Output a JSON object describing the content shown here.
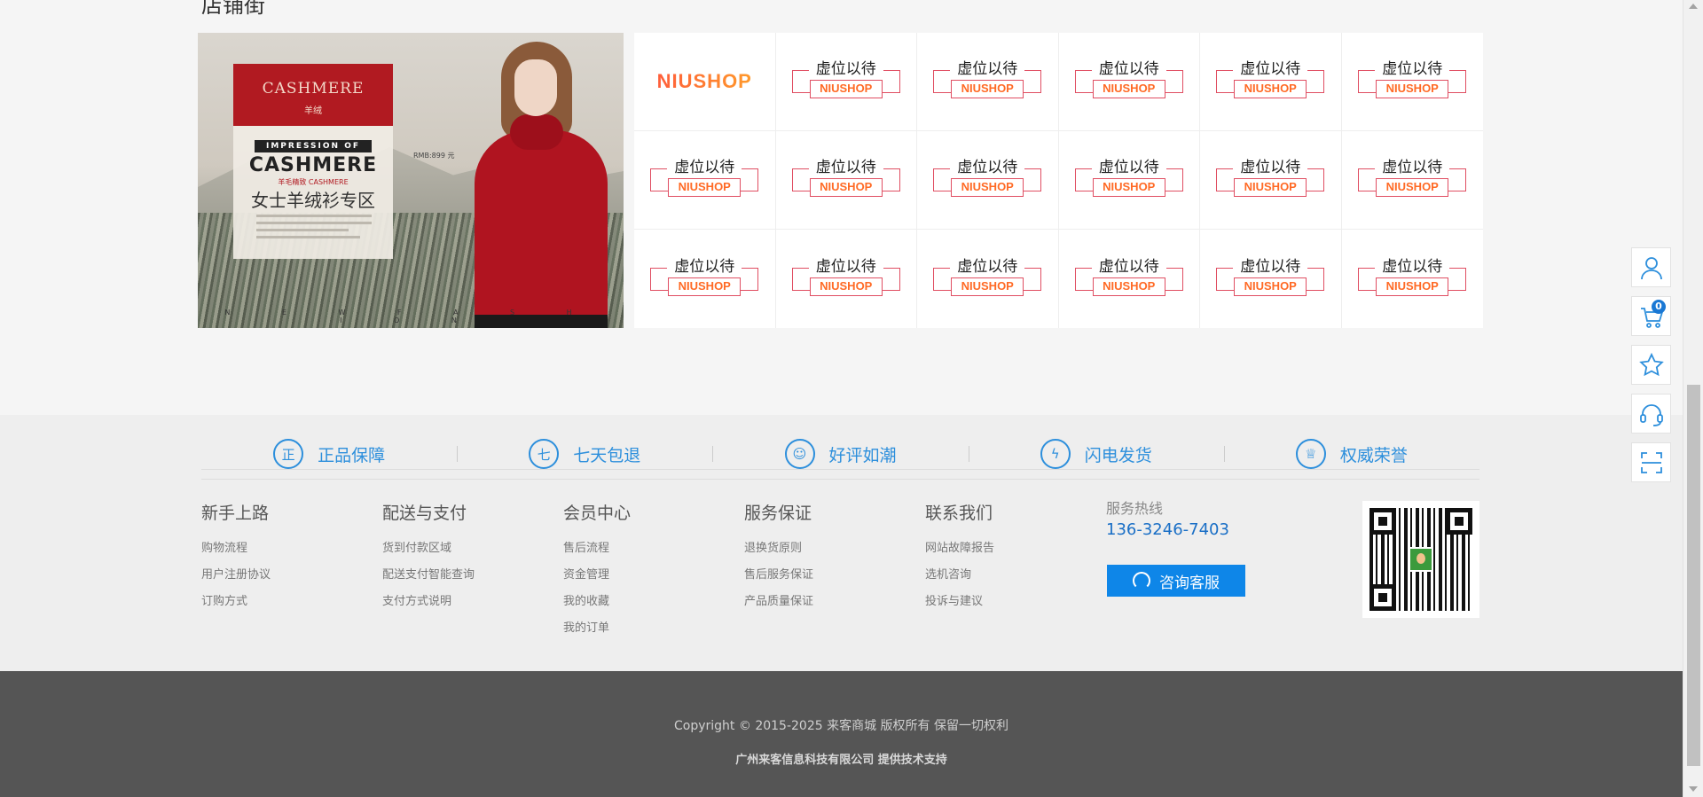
{
  "section": {
    "title": "店铺街"
  },
  "banner": {
    "box_title": "CASHMERE",
    "box_subtitle": "羊绒",
    "impression": "IMPRESSION OF",
    "cashmere": "CASHMERE",
    "tagline": "羊毛精致 CASHMERE",
    "zh_title": "女士羊绒衫专区",
    "price": "RMB:899 元",
    "bottom": "N E W   F A S H I O N"
  },
  "brand_grid": {
    "first_logo": "NIUSHOP",
    "placeholder_top": "虚位以待",
    "placeholder_logo": "NIUSHOP",
    "cells": 18
  },
  "guarantees": [
    {
      "icon": "正",
      "label": "正品保障"
    },
    {
      "icon": "七",
      "label": "七天包退"
    },
    {
      "icon": "☺",
      "label": "好评如潮"
    },
    {
      "icon": "ϟ",
      "label": "闪电发货"
    },
    {
      "icon": "♕",
      "label": "权威荣誉"
    }
  ],
  "footer_columns": [
    {
      "title": "新手上路",
      "links": [
        "购物流程",
        "用户注册协议",
        "订购方式"
      ]
    },
    {
      "title": "配送与支付",
      "links": [
        "货到付款区域",
        "配送支付智能查询",
        "支付方式说明"
      ]
    },
    {
      "title": "会员中心",
      "links": [
        "售后流程",
        "资金管理",
        "我的收藏",
        "我的订单"
      ]
    },
    {
      "title": "服务保证",
      "links": [
        "退换货原则",
        "售后服务保证",
        "产品质量保证"
      ]
    },
    {
      "title": "联系我们",
      "links": [
        "网站故障报告",
        "选机咨询",
        "投诉与建议"
      ]
    }
  ],
  "service": {
    "label": "服务热线",
    "phone": "136-3246-7403",
    "consult_label": "咨询客服"
  },
  "copyright": {
    "line1": "Copyright © 2015-2025 来客商城 版权所有 保留一切权利",
    "line2": "广州来客信息科技有限公司 提供技术支持"
  },
  "toolbar": {
    "cart_count": "0",
    "items": [
      "user-icon",
      "cart-icon",
      "star-icon",
      "headset-icon",
      "scan-icon"
    ]
  },
  "colors": {
    "accent": "#2d8fdc",
    "consult_button": "#0e86e8",
    "footer_bottom": "#555555",
    "brand_orange": "#ff6a25",
    "brand_pink": "#e04e62"
  }
}
